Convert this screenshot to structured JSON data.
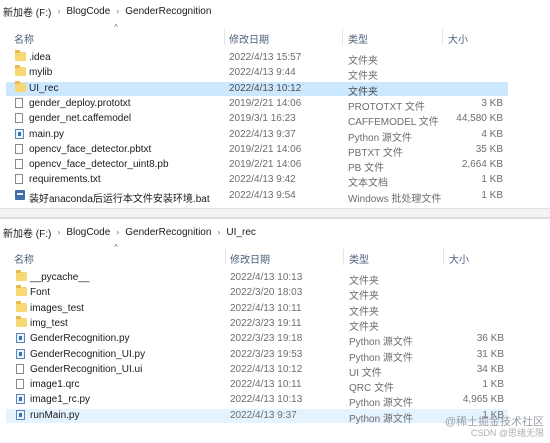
{
  "pane1": {
    "breadcrumb": [
      "新加卷 (F:)",
      "BlogCode",
      "GenderRecognition"
    ],
    "columns": {
      "name": "名称",
      "date": "修改日期",
      "type": "类型",
      "size": "大小"
    },
    "rows": [
      {
        "icon": "folder-icon",
        "name": ".idea",
        "date": "2022/4/13 15:57",
        "type": "文件夹",
        "size": ""
      },
      {
        "icon": "folder-icon",
        "name": "mylib",
        "date": "2022/4/13 9:44",
        "type": "文件夹",
        "size": ""
      },
      {
        "icon": "folder-icon",
        "name": "UI_rec",
        "date": "2022/4/13 10:12",
        "type": "文件夹",
        "size": ""
      },
      {
        "icon": "file-icon",
        "name": "gender_deploy.prototxt",
        "date": "2019/2/21 14:06",
        "type": "PROTOTXT 文件",
        "size": "3 KB"
      },
      {
        "icon": "file-icon",
        "name": "gender_net.caffemodel",
        "date": "2019/3/1 16:23",
        "type": "CAFFEMODEL 文件",
        "size": "44,580 KB"
      },
      {
        "icon": "python-file-icon",
        "name": "main.py",
        "date": "2022/4/13 9:37",
        "type": "Python 源文件",
        "size": "4 KB"
      },
      {
        "icon": "file-icon",
        "name": "opencv_face_detector.pbtxt",
        "date": "2019/2/21 14:06",
        "type": "PBTXT 文件",
        "size": "35 KB"
      },
      {
        "icon": "file-icon",
        "name": "opencv_face_detector_uint8.pb",
        "date": "2019/2/21 14:06",
        "type": "PB 文件",
        "size": "2,664 KB"
      },
      {
        "icon": "file-icon",
        "name": "requirements.txt",
        "date": "2022/4/13 9:42",
        "type": "文本文档",
        "size": "1 KB"
      },
      {
        "icon": "batch-file-icon",
        "name": "装好anaconda后运行本文件安装环境.bat",
        "date": "2022/4/13 9:54",
        "type": "Windows 批处理文件",
        "size": "1 KB"
      }
    ]
  },
  "pane2": {
    "breadcrumb": [
      "新加卷 (F:)",
      "BlogCode",
      "GenderRecognition",
      "UI_rec"
    ],
    "columns": {
      "name": "名称",
      "date": "修改日期",
      "type": "类型",
      "size": "大小"
    },
    "rows": [
      {
        "icon": "folder-icon",
        "name": "__pycache__",
        "date": "2022/4/13 10:13",
        "type": "文件夹",
        "size": ""
      },
      {
        "icon": "folder-icon",
        "name": "Font",
        "date": "2022/3/20 18:03",
        "type": "文件夹",
        "size": ""
      },
      {
        "icon": "folder-icon",
        "name": "images_test",
        "date": "2022/4/13 10:11",
        "type": "文件夹",
        "size": ""
      },
      {
        "icon": "folder-icon",
        "name": "img_test",
        "date": "2022/3/23 19:11",
        "type": "文件夹",
        "size": ""
      },
      {
        "icon": "python-file-icon",
        "name": "GenderRecognition.py",
        "date": "2022/3/23 19:18",
        "type": "Python 源文件",
        "size": "36 KB"
      },
      {
        "icon": "python-file-icon",
        "name": "GenderRecognition_UI.py",
        "date": "2022/3/23 19:53",
        "type": "Python 源文件",
        "size": "31 KB"
      },
      {
        "icon": "file-icon",
        "name": "GenderRecognition_UI.ui",
        "date": "2022/4/13 10:12",
        "type": "UI 文件",
        "size": "34 KB"
      },
      {
        "icon": "file-icon",
        "name": "image1.qrc",
        "date": "2022/4/13 10:11",
        "type": "QRC 文件",
        "size": "1 KB"
      },
      {
        "icon": "python-file-icon",
        "name": "image1_rc.py",
        "date": "2022/4/13 10:13",
        "type": "Python 源文件",
        "size": "4,965 KB"
      },
      {
        "icon": "python-file-icon",
        "name": "runMain.py",
        "date": "2022/4/13 9:37",
        "type": "Python 源文件",
        "size": "1 KB"
      }
    ]
  },
  "watermark": {
    "line1": "@稀土掘金技术社区",
    "line2": "CSDN @思绪无限"
  }
}
